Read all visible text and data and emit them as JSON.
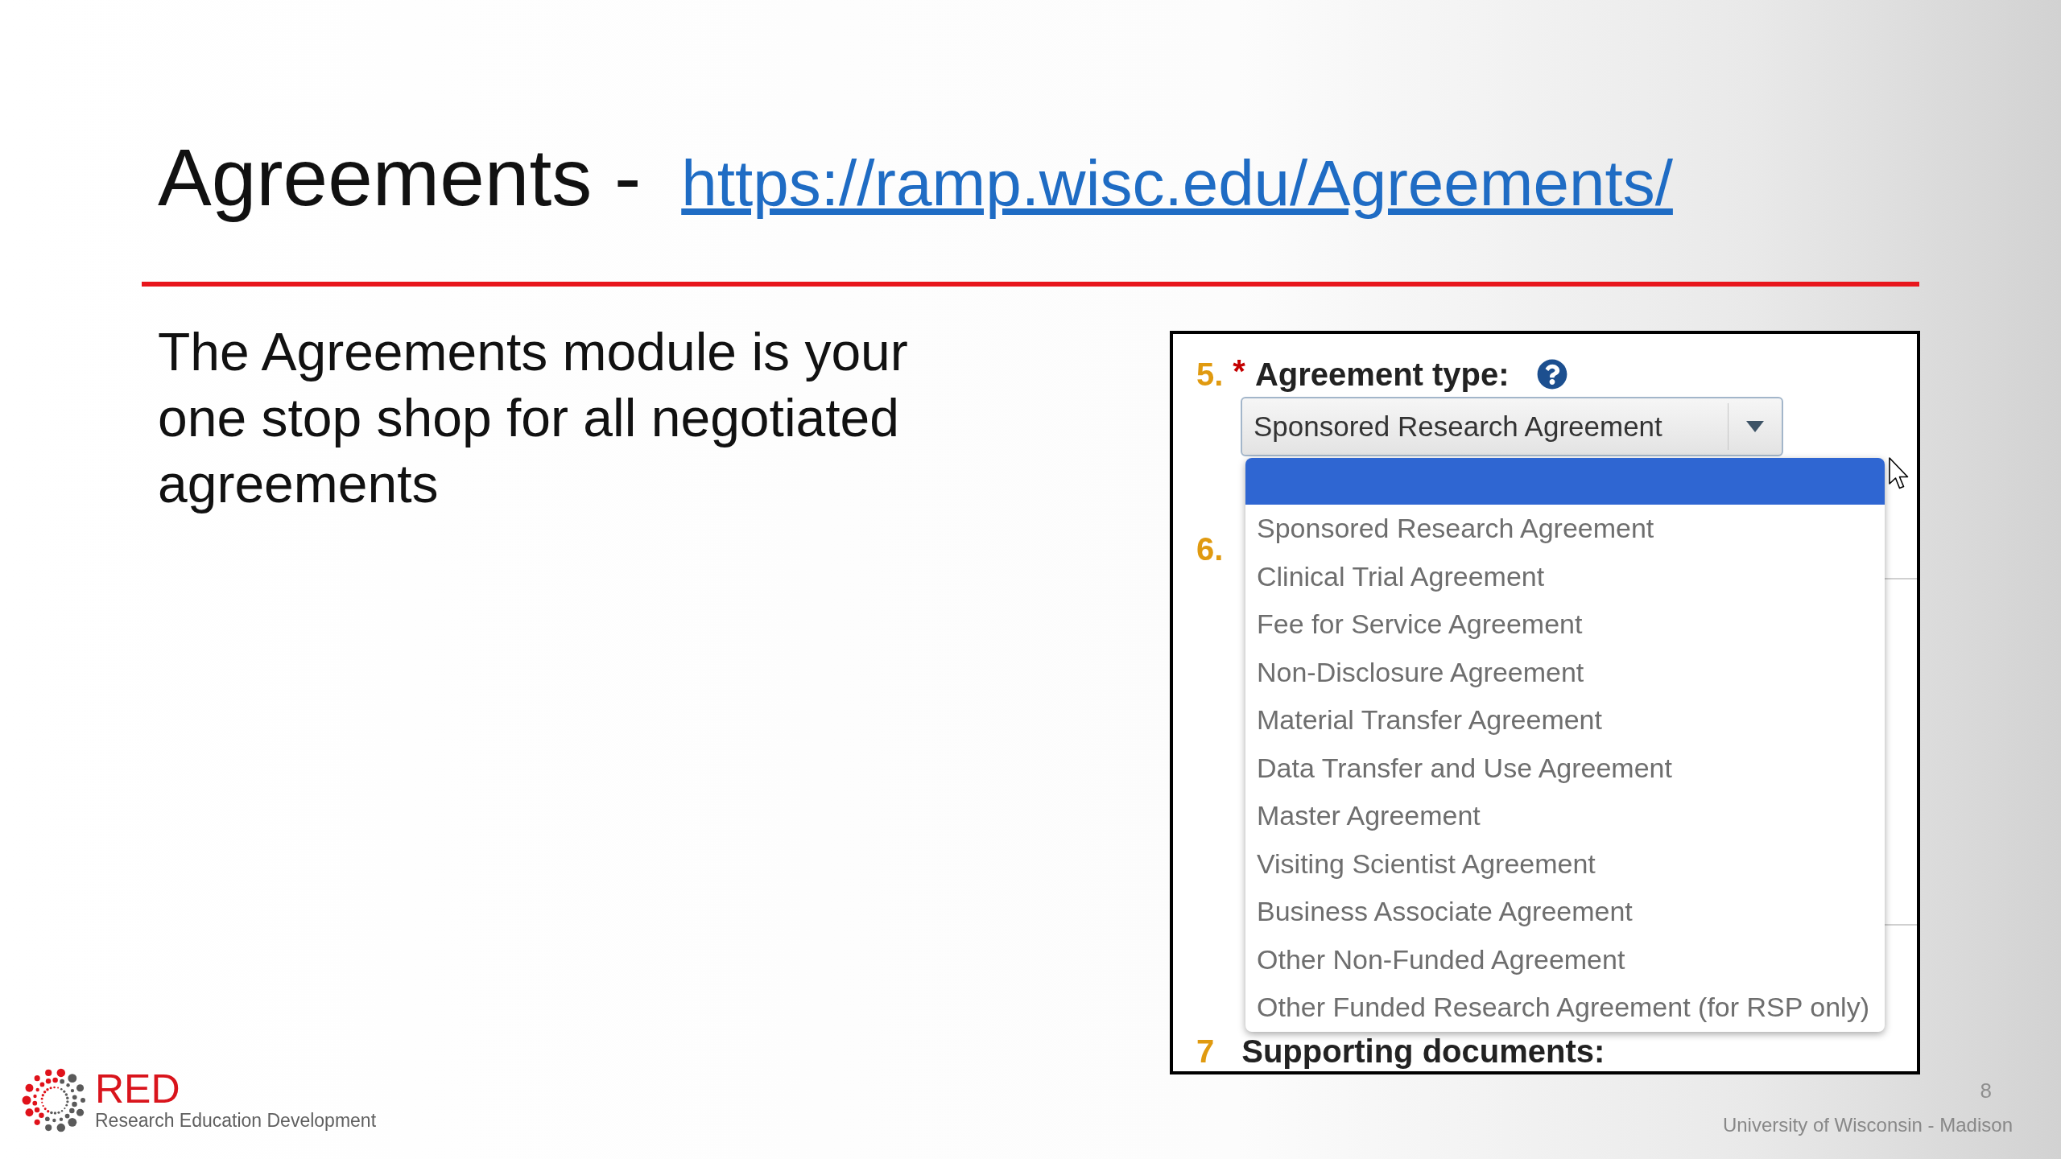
{
  "title": {
    "text": "Agreements -",
    "link": "https://ramp.wisc.edu/Agreements/"
  },
  "body_text": "The Agreements module is your one stop shop for all negotiated agreements",
  "form_screenshot": {
    "fields": [
      {
        "kind": "select",
        "number": "5.",
        "required_mark": "*",
        "label": "Agreement type:",
        "help": true,
        "value": "Sponsored Research Agreement"
      },
      {
        "kind": "text_area",
        "number": "6."
      },
      {
        "kind": "heading",
        "number": "7",
        "label": "Supporting documents:"
      }
    ],
    "dropdown": {
      "blank_option_highlighted": true,
      "options": [
        {
          "label": "Sponsored Research Agreement",
          "selected": false
        },
        {
          "label": "Clinical Trial Agreement",
          "selected": false
        },
        {
          "label": "Fee for Service Agreement",
          "selected": false
        },
        {
          "label": "Non-Disclosure Agreement",
          "selected": false
        },
        {
          "label": "Material Transfer Agreement",
          "selected": false
        },
        {
          "label": "Data Transfer and Use Agreement",
          "selected": false
        },
        {
          "label": "Master Agreement",
          "selected": false
        },
        {
          "label": "Visiting Scientist Agreement",
          "selected": false
        },
        {
          "label": "Business Associate Agreement",
          "selected": false
        },
        {
          "label": "Other Non-Funded Agreement",
          "selected": false
        },
        {
          "label": "Other Funded Research Agreement (for RSP only)",
          "selected": false
        }
      ]
    }
  },
  "footer": {
    "logo": {
      "name": "RED",
      "tagline": "Research Education Development"
    },
    "page_number": "8",
    "organization": "University of Wisconsin - Madison"
  }
}
